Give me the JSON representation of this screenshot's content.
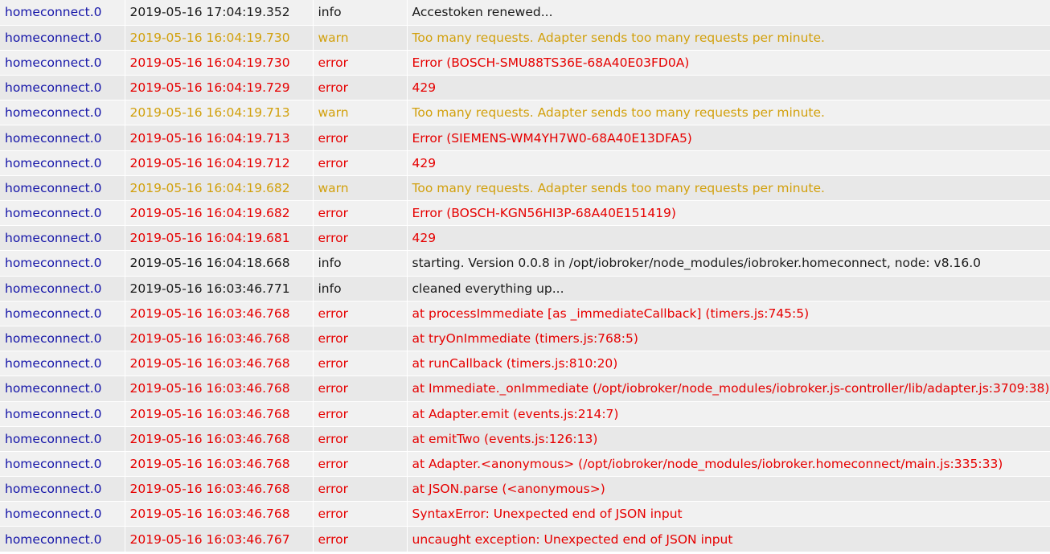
{
  "colors": {
    "adapter": "#1515a8",
    "info": "#1a1a1a",
    "warn": "#d2a00c",
    "error": "#e60000",
    "row_odd": "#f1f1f1",
    "row_even": "#e8e8e8"
  },
  "log": {
    "rows": [
      {
        "adapter": "homeconnect.0",
        "time": "2019-05-16 17:04:19.352",
        "level": "info",
        "message": "Accestoken renewed..."
      },
      {
        "adapter": "homeconnect.0",
        "time": "2019-05-16 16:04:19.730",
        "level": "warn",
        "message": "Too many requests. Adapter sends too many requests per minute."
      },
      {
        "adapter": "homeconnect.0",
        "time": "2019-05-16 16:04:19.730",
        "level": "error",
        "message": "Error (BOSCH-SMU88TS36E-68A40E03FD0A)"
      },
      {
        "adapter": "homeconnect.0",
        "time": "2019-05-16 16:04:19.729",
        "level": "error",
        "message": "429"
      },
      {
        "adapter": "homeconnect.0",
        "time": "2019-05-16 16:04:19.713",
        "level": "warn",
        "message": "Too many requests. Adapter sends too many requests per minute."
      },
      {
        "adapter": "homeconnect.0",
        "time": "2019-05-16 16:04:19.713",
        "level": "error",
        "message": "Error (SIEMENS-WM4YH7W0-68A40E13DFA5)"
      },
      {
        "adapter": "homeconnect.0",
        "time": "2019-05-16 16:04:19.712",
        "level": "error",
        "message": "429"
      },
      {
        "adapter": "homeconnect.0",
        "time": "2019-05-16 16:04:19.682",
        "level": "warn",
        "message": "Too many requests. Adapter sends too many requests per minute."
      },
      {
        "adapter": "homeconnect.0",
        "time": "2019-05-16 16:04:19.682",
        "level": "error",
        "message": "Error (BOSCH-KGN56HI3P-68A40E151419)"
      },
      {
        "adapter": "homeconnect.0",
        "time": "2019-05-16 16:04:19.681",
        "level": "error",
        "message": "429"
      },
      {
        "adapter": "homeconnect.0",
        "time": "2019-05-16 16:04:18.668",
        "level": "info",
        "message": "starting. Version 0.0.8 in /opt/iobroker/node_modules/iobroker.homeconnect, node: v8.16.0"
      },
      {
        "adapter": "homeconnect.0",
        "time": "2019-05-16 16:03:46.771",
        "level": "info",
        "message": "cleaned everything up..."
      },
      {
        "adapter": "homeconnect.0",
        "time": "2019-05-16 16:03:46.768",
        "level": "error",
        "message": "at processImmediate [as _immediateCallback] (timers.js:745:5)"
      },
      {
        "adapter": "homeconnect.0",
        "time": "2019-05-16 16:03:46.768",
        "level": "error",
        "message": "at tryOnImmediate (timers.js:768:5)"
      },
      {
        "adapter": "homeconnect.0",
        "time": "2019-05-16 16:03:46.768",
        "level": "error",
        "message": "at runCallback (timers.js:810:20)"
      },
      {
        "adapter": "homeconnect.0",
        "time": "2019-05-16 16:03:46.768",
        "level": "error",
        "message": "at Immediate._onImmediate (/opt/iobroker/node_modules/iobroker.js-controller/lib/adapter.js:3709:38)"
      },
      {
        "adapter": "homeconnect.0",
        "time": "2019-05-16 16:03:46.768",
        "level": "error",
        "message": "at Adapter.emit (events.js:214:7)"
      },
      {
        "adapter": "homeconnect.0",
        "time": "2019-05-16 16:03:46.768",
        "level": "error",
        "message": "at emitTwo (events.js:126:13)"
      },
      {
        "adapter": "homeconnect.0",
        "time": "2019-05-16 16:03:46.768",
        "level": "error",
        "message": "at Adapter.<anonymous> (/opt/iobroker/node_modules/iobroker.homeconnect/main.js:335:33)"
      },
      {
        "adapter": "homeconnect.0",
        "time": "2019-05-16 16:03:46.768",
        "level": "error",
        "message": "at JSON.parse (<anonymous>)"
      },
      {
        "adapter": "homeconnect.0",
        "time": "2019-05-16 16:03:46.768",
        "level": "error",
        "message": "SyntaxError: Unexpected end of JSON input"
      },
      {
        "adapter": "homeconnect.0",
        "time": "2019-05-16 16:03:46.767",
        "level": "error",
        "message": "uncaught exception: Unexpected end of JSON input"
      }
    ]
  }
}
